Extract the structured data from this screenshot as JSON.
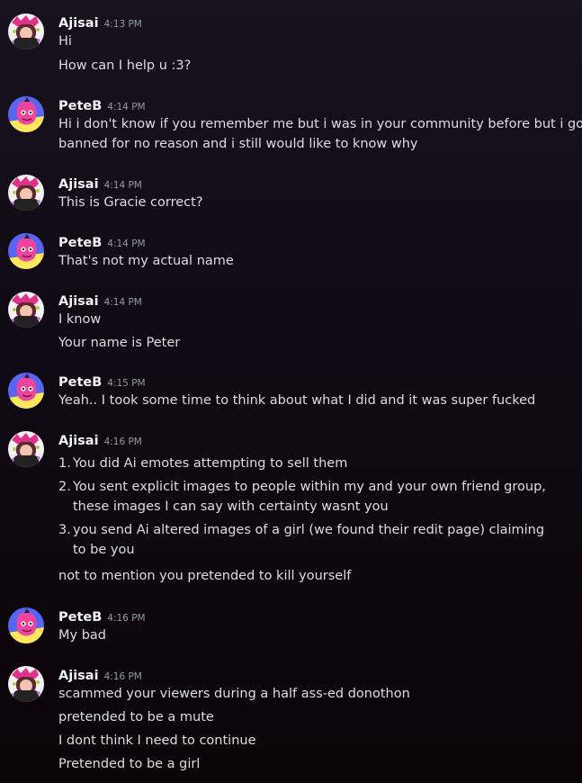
{
  "users": {
    "ajisai": {
      "name": "Ajisai"
    },
    "peteb": {
      "name": "PeteB"
    }
  },
  "colors": {
    "background_top": "#17121d",
    "background_bottom": "#0b0508",
    "text": "#dbdee1",
    "timestamp": "#949ba4",
    "peteb_avatar_bg": "#5865f2",
    "peteb_avatar_face": "#eb459e",
    "peteb_avatar_accent": "#fee75c"
  },
  "messages": [
    {
      "author": "Ajisai",
      "time": "4:13 PM",
      "lines": [
        "Hi",
        "How can I help u :3?"
      ]
    },
    {
      "author": "PeteB",
      "time": "4:14 PM",
      "lines": [
        "Hi i don't know if you remember me but i was in your community before but i got",
        "banned for no reason and i still would like to know why"
      ]
    },
    {
      "author": "Ajisai",
      "time": "4:14 PM",
      "lines": [
        "This is Gracie correct?"
      ]
    },
    {
      "author": "PeteB",
      "time": "4:14 PM",
      "lines": [
        "That's not my actual name"
      ]
    },
    {
      "author": "Ajisai",
      "time": "4:14 PM",
      "lines": [
        "I know",
        "Your name is Peter"
      ]
    },
    {
      "author": "PeteB",
      "time": "4:15 PM",
      "lines": [
        "Yeah.. I took some time to think about what I did and it was super fucked"
      ]
    },
    {
      "author": "Ajisai",
      "time": "4:16 PM",
      "list": [
        {
          "num": "1.",
          "text": "You did Ai emotes attempting to sell them"
        },
        {
          "num": "2.",
          "text": "You sent explicit images to people within my and your own friend group, these images I can say with certainty wasnt you"
        },
        {
          "num": "3.",
          "text": "you send Ai altered images of a girl (we found their redit page) claiming to be you"
        }
      ],
      "after": "not to mention you pretended to kill yourself"
    },
    {
      "author": "PeteB",
      "time": "4:16 PM",
      "lines": [
        "My bad"
      ]
    },
    {
      "author": "Ajisai",
      "time": "4:16 PM",
      "lines": [
        "scammed your viewers during a half ass-ed donothon",
        "pretended to be a mute",
        "I dont think I need to continue",
        "Pretended to be a girl"
      ]
    }
  ]
}
